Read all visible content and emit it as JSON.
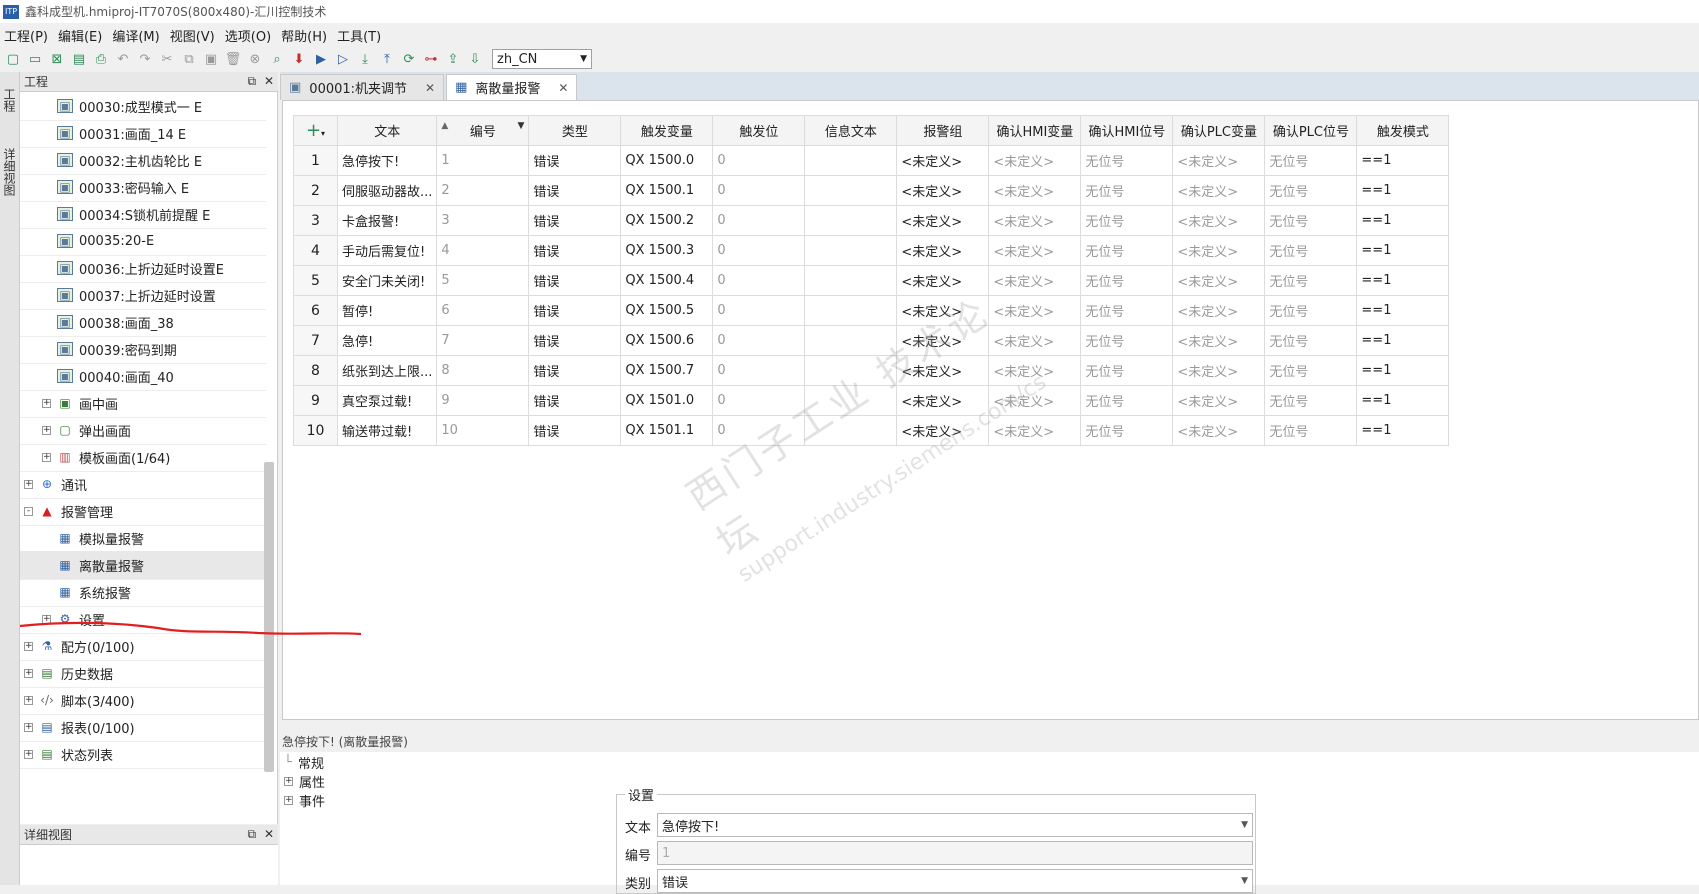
{
  "window": {
    "title": "鑫科成型机.hmiproj-IT7070S(800x480)-汇川控制技术",
    "app_badge": "ITP"
  },
  "menu": [
    "工程(P)",
    "编辑(E)",
    "编译(M)",
    "视图(V)",
    "选项(O)",
    "帮助(H)",
    "工具(T)"
  ],
  "toolbar": {
    "language": "zh_CN"
  },
  "side_rail": {
    "tab1": "工程",
    "tab2": "详细视图"
  },
  "project_panel": {
    "title": "工程",
    "items": [
      {
        "label": "00030:成型模式一 E",
        "type": "screen",
        "indent": 1
      },
      {
        "label": "00031:画面_14 E",
        "type": "screen",
        "indent": 1
      },
      {
        "label": "00032:主机齿轮比 E",
        "type": "screen",
        "indent": 1
      },
      {
        "label": "00033:密码输入 E",
        "type": "screen",
        "indent": 1
      },
      {
        "label": "00034:S锁机前提醒 E",
        "type": "screen",
        "indent": 1
      },
      {
        "label": "00035:20-E",
        "type": "screen",
        "indent": 1
      },
      {
        "label": "00036:上折边延时设置E",
        "type": "screen",
        "indent": 1
      },
      {
        "label": "00037:上折边延时设置",
        "type": "screen",
        "indent": 1
      },
      {
        "label": "00038:画面_38",
        "type": "screen",
        "indent": 1
      },
      {
        "label": "00039:密码到期",
        "type": "screen",
        "indent": 1
      },
      {
        "label": "00040:画面_40",
        "type": "screen",
        "indent": 1
      },
      {
        "label": "画中画",
        "type": "pip",
        "indent": 1,
        "expander": "+"
      },
      {
        "label": "弹出画面",
        "type": "popup",
        "indent": 1,
        "expander": "+"
      },
      {
        "label": "模板画面(1/64)",
        "type": "template",
        "indent": 1,
        "expander": "+"
      },
      {
        "label": "通讯",
        "type": "globe",
        "indent": 0,
        "expander": "+"
      },
      {
        "label": "报警管理",
        "type": "warning",
        "indent": 0,
        "expander": "-"
      },
      {
        "label": "模拟量报警",
        "type": "alarm",
        "indent": 1
      },
      {
        "label": "离散量报警",
        "type": "alarm",
        "indent": 1,
        "selected": true
      },
      {
        "label": "系统报警",
        "type": "alarm",
        "indent": 1
      },
      {
        "label": "设置",
        "type": "gear",
        "indent": 1,
        "expander": "+"
      },
      {
        "label": "配方(0/100)",
        "type": "flask",
        "indent": 0,
        "expander": "+"
      },
      {
        "label": "历史数据",
        "type": "data",
        "indent": 0,
        "expander": "+"
      },
      {
        "label": "脚本(3/400)",
        "type": "code",
        "indent": 0,
        "expander": "+"
      },
      {
        "label": "报表(0/100)",
        "type": "report",
        "indent": 0,
        "expander": "+"
      },
      {
        "label": "状态列表",
        "type": "list",
        "indent": 0,
        "expander": "+"
      }
    ]
  },
  "detail_panel": {
    "title": "详细视图"
  },
  "tabs": [
    {
      "label": "00001:机夹调节",
      "active": false
    },
    {
      "label": "离散量报警",
      "active": true
    }
  ],
  "alarm_table": {
    "add_symbol": "+",
    "columns": [
      "文本",
      "编号",
      "类型",
      "触发变量",
      "触发位",
      "信息文本",
      "报警组",
      "确认HMI变量",
      "确认HMI位号",
      "确认PLC变量",
      "确认PLC位号",
      "触发模式"
    ],
    "rows": [
      [
        "1",
        "急停按下!",
        "1",
        "错误",
        "QX 1500.0",
        "0",
        "",
        "<未定义>",
        "<未定义>",
        "无位号",
        "<未定义>",
        "无位号",
        "==1"
      ],
      [
        "2",
        "伺服驱动器故...",
        "2",
        "错误",
        "QX 1500.1",
        "0",
        "",
        "<未定义>",
        "<未定义>",
        "无位号",
        "<未定义>",
        "无位号",
        "==1"
      ],
      [
        "3",
        "卡盒报警!",
        "3",
        "错误",
        "QX 1500.2",
        "0",
        "",
        "<未定义>",
        "<未定义>",
        "无位号",
        "<未定义>",
        "无位号",
        "==1"
      ],
      [
        "4",
        "手动后需复位!",
        "4",
        "错误",
        "QX 1500.3",
        "0",
        "",
        "<未定义>",
        "<未定义>",
        "无位号",
        "<未定义>",
        "无位号",
        "==1"
      ],
      [
        "5",
        "安全门未关闭!",
        "5",
        "错误",
        "QX 1500.4",
        "0",
        "",
        "<未定义>",
        "<未定义>",
        "无位号",
        "<未定义>",
        "无位号",
        "==1"
      ],
      [
        "6",
        "暂停!",
        "6",
        "错误",
        "QX 1500.5",
        "0",
        "",
        "<未定义>",
        "<未定义>",
        "无位号",
        "<未定义>",
        "无位号",
        "==1"
      ],
      [
        "7",
        "急停!",
        "7",
        "错误",
        "QX 1500.6",
        "0",
        "",
        "<未定义>",
        "<未定义>",
        "无位号",
        "<未定义>",
        "无位号",
        "==1"
      ],
      [
        "8",
        "纸张到达上限...",
        "8",
        "错误",
        "QX 1500.7",
        "0",
        "",
        "<未定义>",
        "<未定义>",
        "无位号",
        "<未定义>",
        "无位号",
        "==1"
      ],
      [
        "9",
        "真空泵过载!",
        "9",
        "错误",
        "QX 1501.0",
        "0",
        "",
        "<未定义>",
        "<未定义>",
        "无位号",
        "<未定义>",
        "无位号",
        "==1"
      ],
      [
        "10",
        "输送带过载!",
        "10",
        "错误",
        "QX 1501.1",
        "0",
        "",
        "<未定义>",
        "<未定义>",
        "无位号",
        "<未定义>",
        "无位号",
        "==1"
      ]
    ]
  },
  "properties": {
    "header": "急停按下!  (离散量报警)",
    "tree": [
      "常规",
      "属性",
      "事件"
    ],
    "settings_title": "设置",
    "text_label": "文本",
    "text_value": "急停按下!",
    "number_label": "编号",
    "number_value": "1",
    "type_label": "类别",
    "type_value": "错误"
  },
  "watermark": {
    "line1": "西门子工业 技术论坛",
    "line2": "support.industry.siemens.com/cs"
  },
  "colors": {
    "accent": "#2e8b57",
    "annotation": "#e02020",
    "warning": "#d42020"
  }
}
